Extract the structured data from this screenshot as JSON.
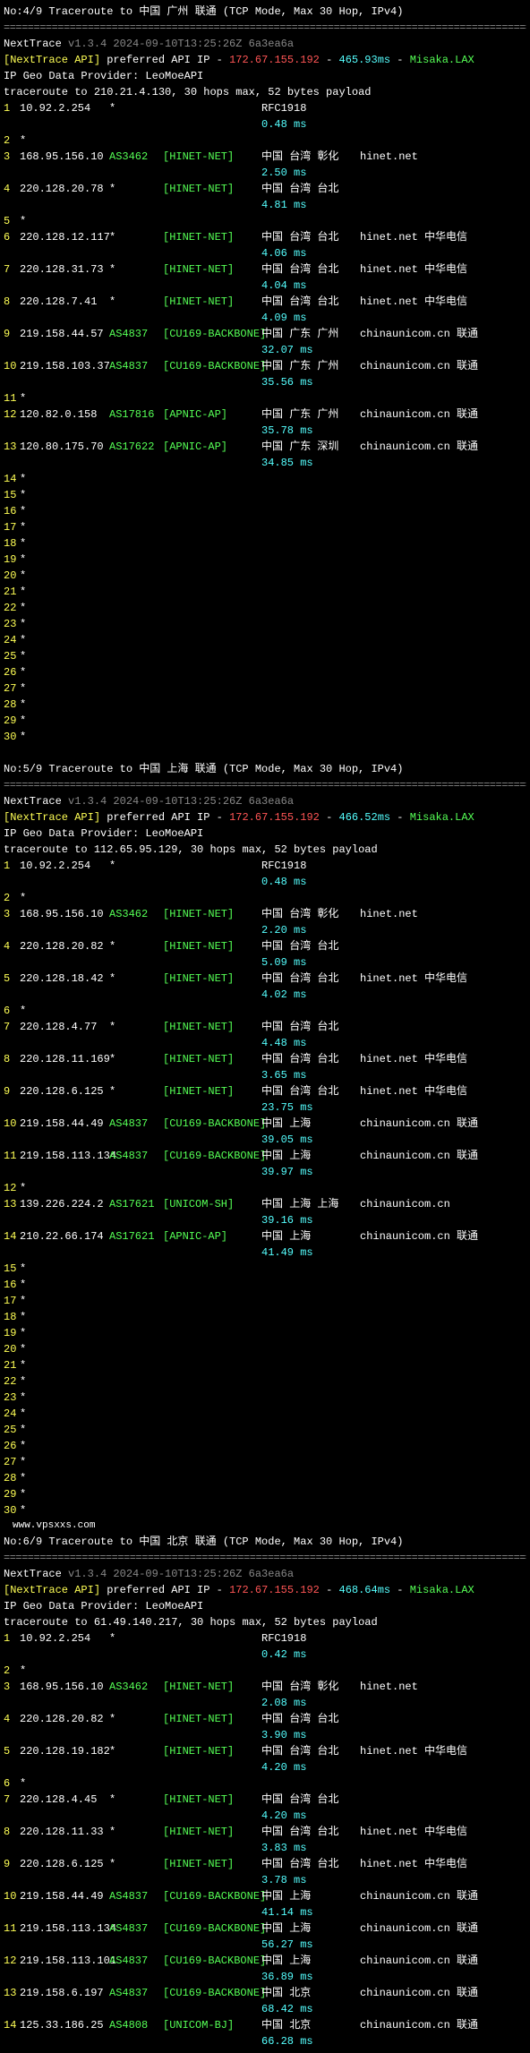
{
  "version_line": "NextTrace v1.3.4 2024-09-10T13:25:26Z 6a3ea6a",
  "api_label": "[NextTrace API]",
  "api_text": " preferred API IP - ",
  "api_ip": "172.67.155.192",
  "geo_provider": "IP Geo Data Provider: LeoMoeAPI",
  "watermark": "www.vpsxxs.com",
  "divider": "==========================================================================================",
  "blocks": [
    {
      "title": "No:4/9 Traceroute to 中国 广州 联通 (TCP Mode, Max 30 Hop, IPv4)",
      "rtt": "465.93ms",
      "server": "Misaka.LAX",
      "trace_line": "traceroute to 210.21.4.130, 30 hops max, 52 bytes payload",
      "hops": [
        {
          "n": "1",
          "ip": "10.92.2.254",
          "asn": "*",
          "net": "",
          "loc": "RFC1918",
          "host": "",
          "ms": "0.48 ms"
        },
        {
          "n": "2",
          "ip": "*",
          "star": true
        },
        {
          "n": "3",
          "ip": "168.95.156.10",
          "asn": "AS3462",
          "net": "[HINET-NET]",
          "loc": "中国 台湾 彰化",
          "host": "hinet.net",
          "ms": "2.50 ms"
        },
        {
          "n": "4",
          "ip": "220.128.20.78",
          "asn": "*",
          "net": "[HINET-NET]",
          "loc": "中国 台湾 台北",
          "host": "",
          "ms": "4.81 ms"
        },
        {
          "n": "5",
          "ip": "*",
          "star": true
        },
        {
          "n": "6",
          "ip": "220.128.12.117",
          "asn": "*",
          "net": "[HINET-NET]",
          "loc": "中国 台湾 台北",
          "host": "hinet.net  中华电信",
          "ms": "4.06 ms"
        },
        {
          "n": "7",
          "ip": "220.128.31.73",
          "asn": "*",
          "net": "[HINET-NET]",
          "loc": "中国 台湾 台北",
          "host": "hinet.net  中华电信",
          "ms": "4.04 ms"
        },
        {
          "n": "8",
          "ip": "220.128.7.41",
          "asn": "*",
          "net": "[HINET-NET]",
          "loc": "中国 台湾 台北",
          "host": "hinet.net  中华电信",
          "ms": "4.09 ms"
        },
        {
          "n": "9",
          "ip": "219.158.44.57",
          "asn": "AS4837",
          "net": "[CU169-BACKBONE]",
          "loc": "中国 广东 广州",
          "host": "chinaunicom.cn  联通",
          "ms": "32.07 ms"
        },
        {
          "n": "10",
          "ip": "219.158.103.37",
          "asn": "AS4837",
          "net": "[CU169-BACKBONE]",
          "loc": "中国 广东 广州",
          "host": "chinaunicom.cn  联通",
          "ms": "35.56 ms"
        },
        {
          "n": "11",
          "ip": "*",
          "star": true
        },
        {
          "n": "12",
          "ip": "120.82.0.158",
          "asn": "AS17816",
          "net": "[APNIC-AP]",
          "loc": "中国 广东 广州",
          "host": "chinaunicom.cn  联通",
          "ms": "35.78 ms"
        },
        {
          "n": "13",
          "ip": "120.80.175.70",
          "asn": "AS17622",
          "net": "[APNIC-AP]",
          "loc": "中国 广东 深圳",
          "host": "chinaunicom.cn  联通",
          "ms": "34.85 ms"
        },
        {
          "n": "14",
          "ip": "*",
          "star": true
        },
        {
          "n": "15",
          "ip": "*",
          "star": true
        },
        {
          "n": "16",
          "ip": "*",
          "star": true
        },
        {
          "n": "17",
          "ip": "*",
          "star": true
        },
        {
          "n": "18",
          "ip": "*",
          "star": true
        },
        {
          "n": "19",
          "ip": "*",
          "star": true
        },
        {
          "n": "20",
          "ip": "*",
          "star": true
        },
        {
          "n": "21",
          "ip": "*",
          "star": true
        },
        {
          "n": "22",
          "ip": "*",
          "star": true
        },
        {
          "n": "23",
          "ip": "*",
          "star": true
        },
        {
          "n": "24",
          "ip": "*",
          "star": true
        },
        {
          "n": "25",
          "ip": "*",
          "star": true
        },
        {
          "n": "26",
          "ip": "*",
          "star": true
        },
        {
          "n": "27",
          "ip": "*",
          "star": true
        },
        {
          "n": "28",
          "ip": "*",
          "star": true
        },
        {
          "n": "29",
          "ip": "*",
          "star": true
        },
        {
          "n": "30",
          "ip": "*",
          "star": true
        }
      ]
    },
    {
      "title": "No:5/9 Traceroute to 中国 上海 联通 (TCP Mode, Max 30 Hop, IPv4)",
      "rtt": "466.52ms",
      "server": "Misaka.LAX",
      "trace_line": "traceroute to 112.65.95.129, 30 hops max, 52 bytes payload",
      "hops": [
        {
          "n": "1",
          "ip": "10.92.2.254",
          "asn": "*",
          "net": "",
          "loc": "RFC1918",
          "host": "",
          "ms": "0.48 ms"
        },
        {
          "n": "2",
          "ip": "*",
          "star": true
        },
        {
          "n": "3",
          "ip": "168.95.156.10",
          "asn": "AS3462",
          "net": "[HINET-NET]",
          "loc": "中国 台湾 彰化",
          "host": "hinet.net",
          "ms": "2.20 ms"
        },
        {
          "n": "4",
          "ip": "220.128.20.82",
          "asn": "*",
          "net": "[HINET-NET]",
          "loc": "中国 台湾 台北",
          "host": "",
          "ms": "5.09 ms"
        },
        {
          "n": "5",
          "ip": "220.128.18.42",
          "asn": "*",
          "net": "[HINET-NET]",
          "loc": "中国 台湾 台北",
          "host": "hinet.net  中华电信",
          "ms": "4.02 ms"
        },
        {
          "n": "6",
          "ip": "*",
          "star": true
        },
        {
          "n": "7",
          "ip": "220.128.4.77",
          "asn": "*",
          "net": "[HINET-NET]",
          "loc": "中国 台湾 台北",
          "host": "",
          "ms": "4.48 ms"
        },
        {
          "n": "8",
          "ip": "220.128.11.169",
          "asn": "*",
          "net": "[HINET-NET]",
          "loc": "中国 台湾 台北",
          "host": "hinet.net  中华电信",
          "ms": "3.65 ms"
        },
        {
          "n": "9",
          "ip": "220.128.6.125",
          "asn": "*",
          "net": "[HINET-NET]",
          "loc": "中国 台湾 台北",
          "host": "hinet.net  中华电信",
          "ms": "23.75 ms"
        },
        {
          "n": "10",
          "ip": "219.158.44.49",
          "asn": "AS4837",
          "net": "[CU169-BACKBONE]",
          "loc": "中国 上海",
          "host": "chinaunicom.cn  联通",
          "ms": "39.05 ms"
        },
        {
          "n": "11",
          "ip": "219.158.113.134",
          "asn": "AS4837",
          "net": "[CU169-BACKBONE]",
          "loc": "中国 上海",
          "host": "chinaunicom.cn  联通",
          "ms": "39.97 ms"
        },
        {
          "n": "12",
          "ip": "*",
          "star": true
        },
        {
          "n": "13",
          "ip": "139.226.224.2",
          "asn": "AS17621",
          "net": "[UNICOM-SH]",
          "loc": "中国 上海 上海",
          "host": "chinaunicom.cn",
          "ms": "39.16 ms"
        },
        {
          "n": "14",
          "ip": "210.22.66.174",
          "asn": "AS17621",
          "net": "[APNIC-AP]",
          "loc": "中国 上海",
          "host": "chinaunicom.cn  联通",
          "ms": "41.49 ms"
        },
        {
          "n": "15",
          "ip": "*",
          "star": true
        },
        {
          "n": "16",
          "ip": "*",
          "star": true
        },
        {
          "n": "17",
          "ip": "*",
          "star": true
        },
        {
          "n": "18",
          "ip": "*",
          "star": true
        },
        {
          "n": "19",
          "ip": "*",
          "star": true
        },
        {
          "n": "20",
          "ip": "*",
          "star": true
        },
        {
          "n": "21",
          "ip": "*",
          "star": true
        },
        {
          "n": "22",
          "ip": "*",
          "star": true
        },
        {
          "n": "23",
          "ip": "*",
          "star": true
        },
        {
          "n": "24",
          "ip": "*",
          "star": true
        },
        {
          "n": "25",
          "ip": "*",
          "star": true
        },
        {
          "n": "26",
          "ip": "*",
          "star": true
        },
        {
          "n": "27",
          "ip": "*",
          "star": true
        },
        {
          "n": "28",
          "ip": "*",
          "star": true
        },
        {
          "n": "29",
          "ip": "*",
          "star": true
        },
        {
          "n": "30",
          "ip": "*",
          "star": true
        }
      ],
      "watermark_after": true
    },
    {
      "title": "No:6/9 Traceroute to 中国 北京 联通 (TCP Mode, Max 30 Hop, IPv4)",
      "rtt": "468.64ms",
      "server": "Misaka.LAX",
      "trace_line": "traceroute to 61.49.140.217, 30 hops max, 52 bytes payload",
      "hops": [
        {
          "n": "1",
          "ip": "10.92.2.254",
          "asn": "*",
          "net": "",
          "loc": "RFC1918",
          "host": "",
          "ms": "0.42 ms"
        },
        {
          "n": "2",
          "ip": "*",
          "star": true
        },
        {
          "n": "3",
          "ip": "168.95.156.10",
          "asn": "AS3462",
          "net": "[HINET-NET]",
          "loc": "中国 台湾 彰化",
          "host": "hinet.net",
          "ms": "2.08 ms"
        },
        {
          "n": "4",
          "ip": "220.128.20.82",
          "asn": "*",
          "net": "[HINET-NET]",
          "loc": "中国 台湾 台北",
          "host": "",
          "ms": "3.90 ms"
        },
        {
          "n": "5",
          "ip": "220.128.19.182",
          "asn": "*",
          "net": "[HINET-NET]",
          "loc": "中国 台湾 台北",
          "host": "hinet.net  中华电信",
          "ms": "4.20 ms"
        },
        {
          "n": "6",
          "ip": "*",
          "star": true
        },
        {
          "n": "7",
          "ip": "220.128.4.45",
          "asn": "*",
          "net": "[HINET-NET]",
          "loc": "中国 台湾 台北",
          "host": "",
          "ms": "4.20 ms"
        },
        {
          "n": "8",
          "ip": "220.128.11.33",
          "asn": "*",
          "net": "[HINET-NET]",
          "loc": "中国 台湾 台北",
          "host": "hinet.net  中华电信",
          "ms": "3.83 ms"
        },
        {
          "n": "9",
          "ip": "220.128.6.125",
          "asn": "*",
          "net": "[HINET-NET]",
          "loc": "中国 台湾 台北",
          "host": "hinet.net  中华电信",
          "ms": "3.78 ms"
        },
        {
          "n": "10",
          "ip": "219.158.44.49",
          "asn": "AS4837",
          "net": "[CU169-BACKBONE]",
          "loc": "中国 上海",
          "host": "chinaunicom.cn  联通",
          "ms": "41.14 ms"
        },
        {
          "n": "11",
          "ip": "219.158.113.134",
          "asn": "AS4837",
          "net": "[CU169-BACKBONE]",
          "loc": "中国 上海",
          "host": "chinaunicom.cn  联通",
          "ms": "56.27 ms"
        },
        {
          "n": "12",
          "ip": "219.158.113.101",
          "asn": "AS4837",
          "net": "[CU169-BACKBONE]",
          "loc": "中国 上海",
          "host": "chinaunicom.cn  联通",
          "ms": "36.89 ms"
        },
        {
          "n": "13",
          "ip": "219.158.6.197",
          "asn": "AS4837",
          "net": "[CU169-BACKBONE]",
          "loc": "中国 北京",
          "host": "chinaunicom.cn  联通",
          "ms": "68.42 ms"
        },
        {
          "n": "14",
          "ip": "125.33.186.25",
          "asn": "AS4808",
          "net": "[UNICOM-BJ]",
          "loc": "中国 北京",
          "host": "chinaunicom.cn  联通",
          "ms": "66.28 ms"
        }
      ]
    }
  ]
}
